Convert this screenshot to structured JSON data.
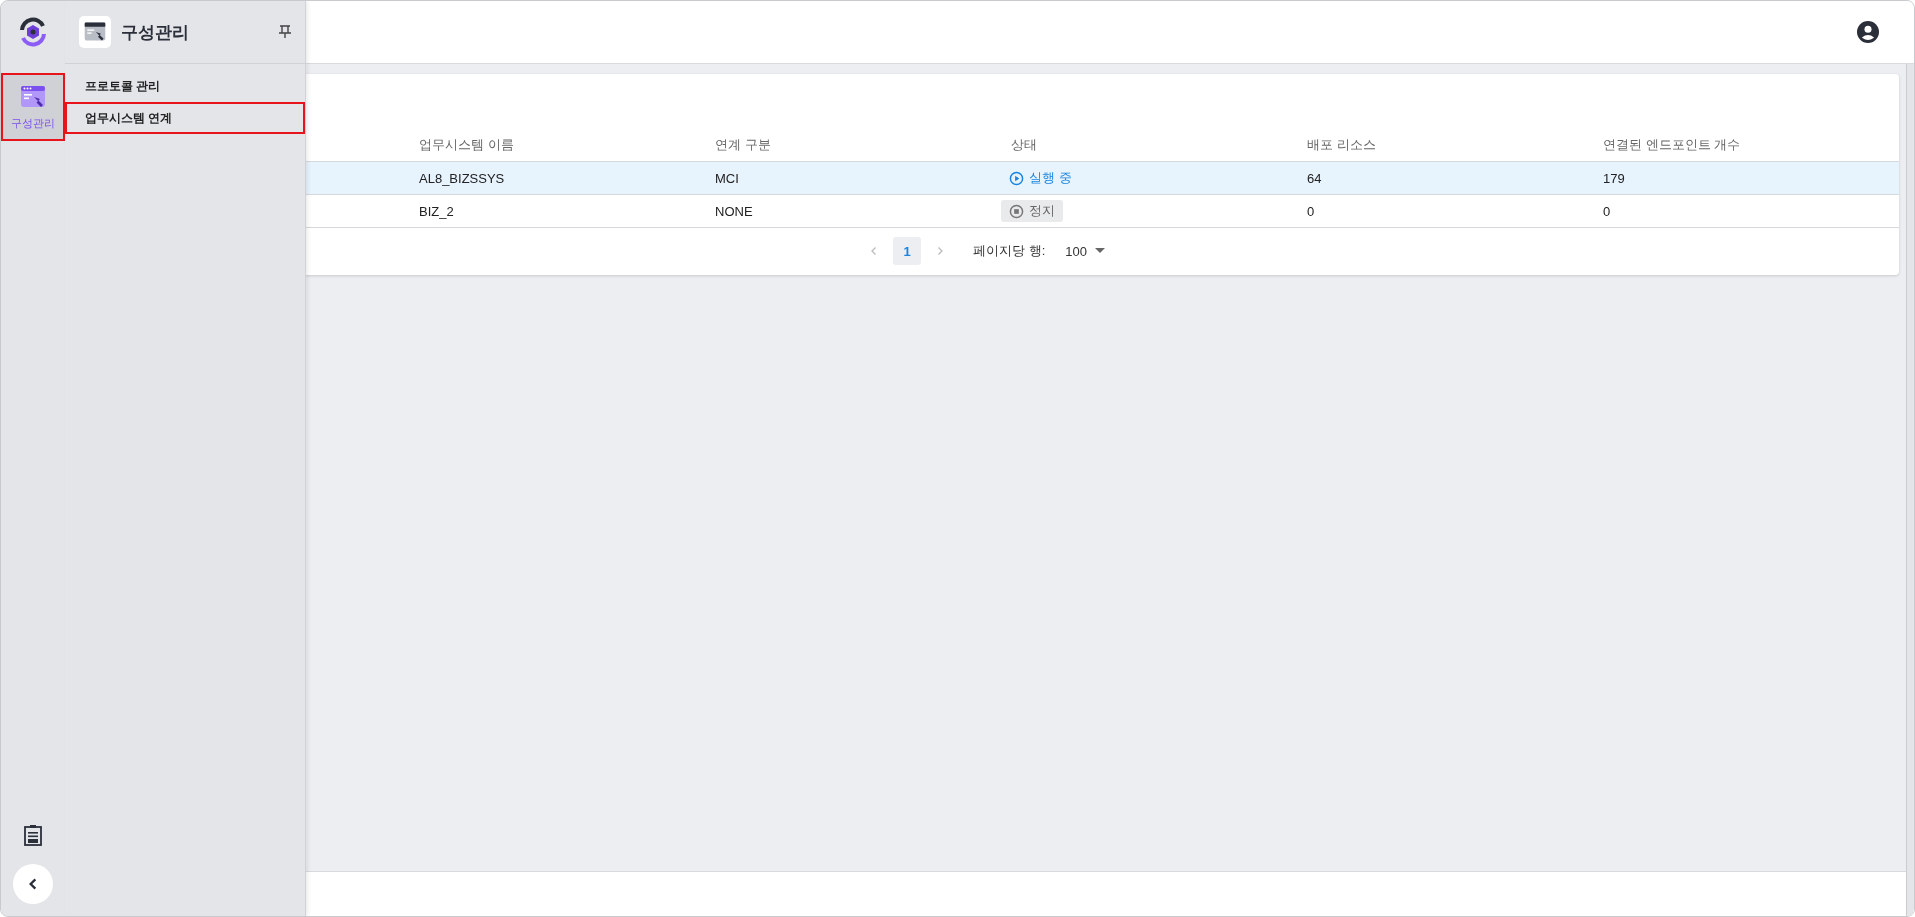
{
  "rail": {
    "items": [
      {
        "label": "구성관리",
        "selected": true
      }
    ]
  },
  "flyout": {
    "title": "구성관리",
    "items": [
      {
        "label": "프로토콜 관리",
        "selected": false
      },
      {
        "label": "업무시스템 연계",
        "selected": true
      }
    ]
  },
  "table": {
    "columns": [
      "업무시스템 이름",
      "연계 구분",
      "상태",
      "배포 리소스",
      "연결된 엔드포인트 개수"
    ],
    "rows": [
      {
        "selected": true,
        "name": "AL8_BIZSSYS",
        "link_type": "MCI",
        "status": {
          "kind": "running",
          "label": "실행 중"
        },
        "resources": "64",
        "endpoints": "179"
      },
      {
        "selected": false,
        "name": "BIZ_2",
        "link_type": "NONE",
        "status": {
          "kind": "stopped",
          "label": "정지"
        },
        "resources": "0",
        "endpoints": "0"
      }
    ]
  },
  "pagination": {
    "pages": [
      {
        "label": "1",
        "selected": true
      }
    ],
    "rows_per_page_label": "페이지당 행:",
    "rows_per_page": "100"
  }
}
